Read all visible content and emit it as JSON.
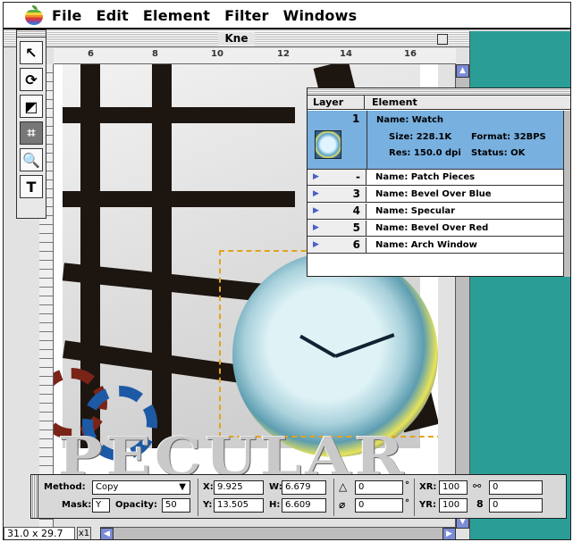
{
  "menubar": {
    "items": [
      "File",
      "Edit",
      "Element",
      "Filter",
      "Windows"
    ]
  },
  "document": {
    "title": "Kne",
    "ruler_numbers": [
      "6",
      "8",
      "10",
      "12",
      "14",
      "16"
    ],
    "zoom_value": "31.0 x 29.7",
    "zoom_button": "x1",
    "logo_text": "PECULAR"
  },
  "tools": [
    "arrow-tool",
    "rotate-tool",
    "distort-tool",
    "crop-tool",
    "zoom-tool",
    "text-tool"
  ],
  "tool_glyphs": [
    "↖",
    "⟳",
    "◩",
    "⌗",
    "🔍",
    "T"
  ],
  "layers": {
    "col_layer": "Layer",
    "col_element": "Element",
    "selected": {
      "number": "1",
      "name": "Name: Watch",
      "size": "Size: 228.1K",
      "format": "Format: 32BPS",
      "res": "Res: 150.0 dpi",
      "status": "Status: OK"
    },
    "rows": [
      {
        "number": "-",
        "name": "Name: Patch Pieces"
      },
      {
        "number": "3",
        "name": "Name: Bevel Over Blue"
      },
      {
        "number": "4",
        "name": "Name: Specular"
      },
      {
        "number": "5",
        "name": "Name: Bevel Over Red"
      },
      {
        "number": "6",
        "name": "Name: Arch Window"
      }
    ]
  },
  "infobar": {
    "method_label": "Method:",
    "method_value": "Copy",
    "mask_label": "Mask:",
    "mask_value": "Y",
    "opacity_label": "Opacity:",
    "opacity_value": "50",
    "x_label": "X:",
    "x_value": "9.925",
    "y_label": "Y:",
    "y_value": "13.505",
    "w_label": "W:",
    "w_value": "6.679",
    "h_label": "H:",
    "h_value": "6.609",
    "angle_value": "0",
    "skew_value": "0",
    "xr_label": "XR:",
    "xr_value": "100",
    "yr_label": "YR:",
    "yr_value": "100",
    "extra1_value": "0",
    "extra2_value": "0"
  }
}
